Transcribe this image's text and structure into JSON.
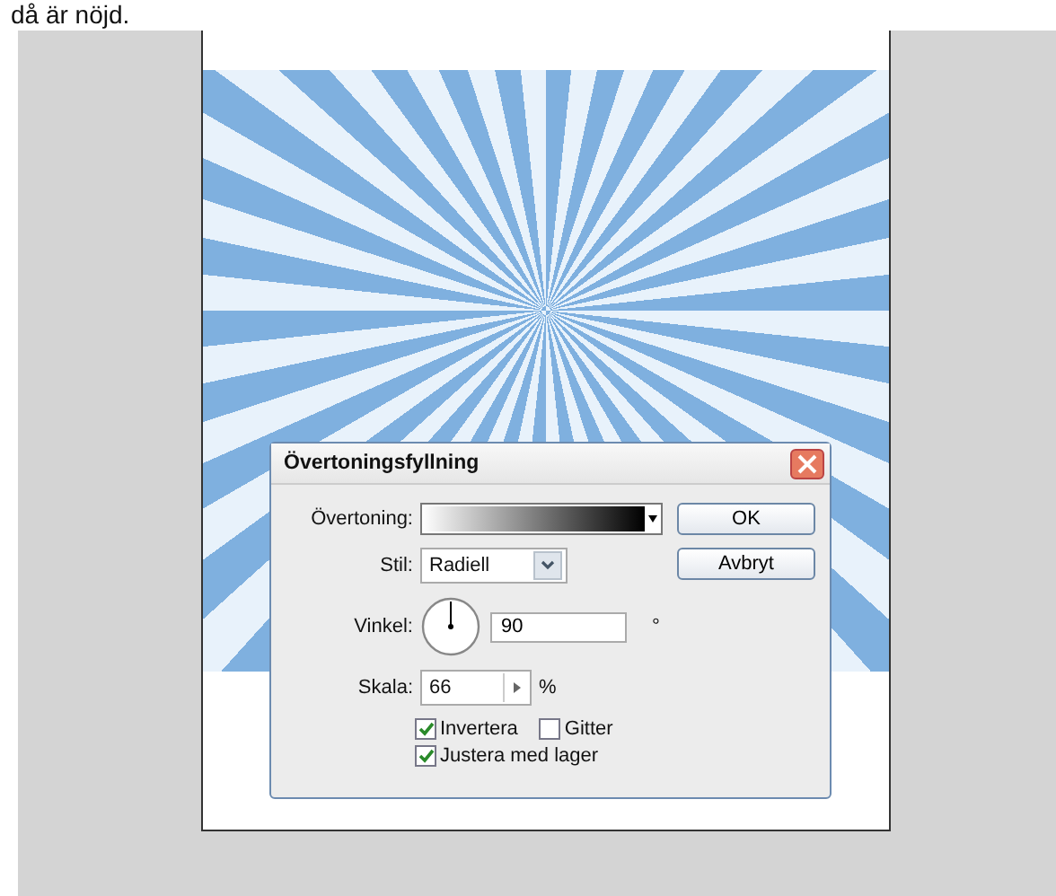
{
  "page_text": "då är nöjd.",
  "dialog": {
    "title": "Övertoningsfyllning",
    "gradient_label": "Övertoning:",
    "style_label": "Stil:",
    "style_value": "Radiell",
    "angle_label": "Vinkel:",
    "angle_value": "90",
    "angle_unit": "°",
    "scale_label": "Skala:",
    "scale_value": "66",
    "scale_unit": "%",
    "checkboxes": [
      {
        "label": "Invertera",
        "checked": true
      },
      {
        "label": "Gitter",
        "checked": false
      },
      {
        "label": "Justera med lager",
        "checked": true
      }
    ],
    "buttons": [
      "OK",
      "Avbryt"
    ]
  }
}
